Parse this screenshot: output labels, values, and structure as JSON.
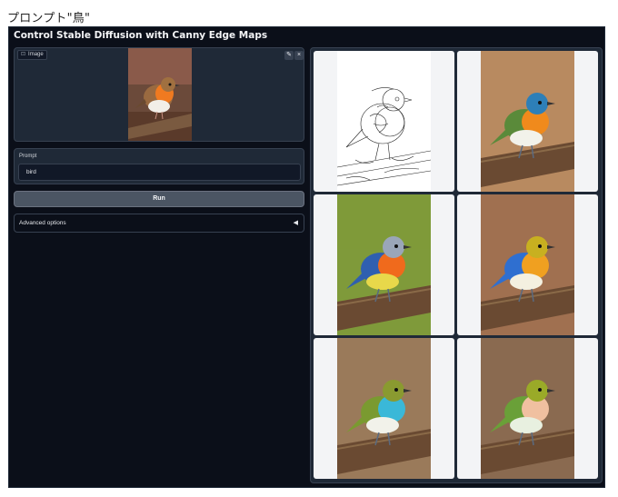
{
  "caption": "プロンプト\"鳥\"",
  "app": {
    "title": "Control Stable Diffusion with Canny Edge Maps"
  },
  "image_input": {
    "label": "Image",
    "edit_icon": "pencil-icon",
    "clear_icon": "close-icon"
  },
  "prompt": {
    "label": "Prompt",
    "value": "bird"
  },
  "run_button": {
    "label": "Run"
  },
  "advanced": {
    "label": "Advanced options",
    "arrow": "◀"
  },
  "gallery": {
    "tiles": [
      {
        "kind": "edge-map"
      },
      {
        "kind": "bird",
        "head": "#2d7fb8",
        "chest": "#f08a1c",
        "wing": "#5a8a3a",
        "belly": "#f2f2ea",
        "bg": "#b88a60"
      },
      {
        "kind": "bird",
        "head": "#9aa6b8",
        "chest": "#f06a1c",
        "wing": "#2f5fb0",
        "belly": "#e8d84a",
        "bg": "#7f9a3a"
      },
      {
        "kind": "bird",
        "head": "#c8b020",
        "chest": "#f0a020",
        "wing": "#2f6fd0",
        "belly": "#f4f0e0",
        "bg": "#a07050"
      },
      {
        "kind": "bird",
        "head": "#8a9a30",
        "chest": "#3ab8d8",
        "wing": "#7a9a30",
        "belly": "#f2f2ea",
        "bg": "#9a7a5a"
      },
      {
        "kind": "bird",
        "head": "#9aaa28",
        "chest": "#f0c0a0",
        "wing": "#6aa038",
        "belly": "#e8f0e0",
        "bg": "#8a6a50"
      }
    ]
  }
}
